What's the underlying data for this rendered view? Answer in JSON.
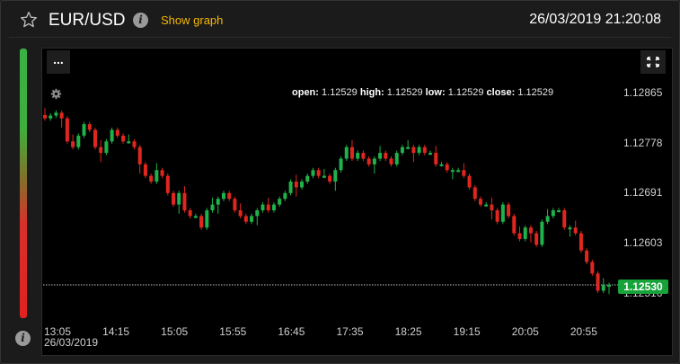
{
  "header": {
    "pair": "EUR/USD",
    "show_graph": "Show graph",
    "timestamp": "26/03/2019 21:20:08"
  },
  "chart": {
    "menu_label": "...",
    "ohlc": {
      "open_label": "open:",
      "open": "1.12529",
      "high_label": "high:",
      "high": "1.12529",
      "low_label": "low:",
      "low": "1.12529",
      "close_label": "close:",
      "close": "1.12529"
    },
    "current_price": "1.12530",
    "date_label": "26/03/2019",
    "colors": {
      "up": "#1fb24a",
      "down": "#e0271f",
      "price_tag": "#17a33a"
    }
  },
  "chart_data": {
    "type": "candlestick",
    "y_ticks": [
      "1.12865",
      "1.12778",
      "1.12691",
      "1.12603",
      "1.12516"
    ],
    "x_ticks": [
      "13:05",
      "14:15",
      "15:05",
      "15:55",
      "16:45",
      "17:35",
      "18:25",
      "19:15",
      "20:05",
      "20:55"
    ],
    "ylim": [
      1.1249,
      1.1289
    ],
    "current": 1.1253,
    "closes": [
      1.1282,
      1.12825,
      1.1283,
      1.1282,
      1.1278,
      1.1277,
      1.1279,
      1.1281,
      1.128,
      1.1277,
      1.1276,
      1.1278,
      1.128,
      1.1279,
      1.1278,
      1.1278,
      1.1277,
      1.1274,
      1.1272,
      1.1271,
      1.1273,
      1.1272,
      1.1269,
      1.1267,
      1.1269,
      1.1266,
      1.1265,
      1.1265,
      1.1263,
      1.1266,
      1.1267,
      1.1268,
      1.1269,
      1.1268,
      1.1266,
      1.1265,
      1.1264,
      1.1265,
      1.1266,
      1.1267,
      1.1266,
      1.1267,
      1.1268,
      1.1269,
      1.1271,
      1.127,
      1.1271,
      1.1272,
      1.1273,
      1.1272,
      1.1272,
      1.1271,
      1.1273,
      1.1275,
      1.1277,
      1.1275,
      1.1276,
      1.1275,
      1.1274,
      1.1275,
      1.1276,
      1.1275,
      1.1274,
      1.1276,
      1.1277,
      1.1277,
      1.1276,
      1.1277,
      1.1276,
      1.1276,
      1.1274,
      1.1274,
      1.1273,
      1.1273,
      1.1273,
      1.1272,
      1.127,
      1.1268,
      1.1267,
      1.1267,
      1.1266,
      1.1264,
      1.1267,
      1.1265,
      1.1262,
      1.1261,
      1.1263,
      1.1262,
      1.126,
      1.1264,
      1.1265,
      1.1266,
      1.1266,
      1.1263,
      1.1263,
      1.1262,
      1.1259,
      1.1257,
      1.1255,
      1.1252,
      1.1253,
      1.1253
    ]
  }
}
